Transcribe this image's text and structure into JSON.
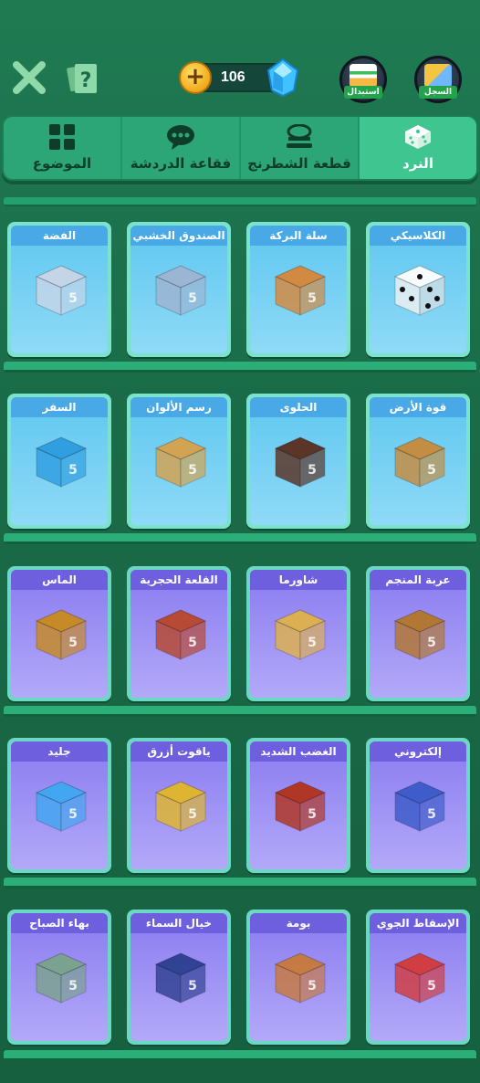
{
  "header": {
    "close_icon": "close-icon",
    "help_icon": "help-icon",
    "gem_count": "106",
    "coin_symbol": "+",
    "exchange_label": "استبدال",
    "history_label": "السجل"
  },
  "tabs": [
    {
      "label": "الموضوع",
      "icon": "grid-icon",
      "active": false
    },
    {
      "label": "فقاعة الدردشة",
      "icon": "chat-bubble-icon",
      "active": false
    },
    {
      "label": "قطعة الشطرنج",
      "icon": "chess-piece-icon",
      "active": false
    },
    {
      "label": "النرد",
      "icon": "dice-icon",
      "active": true
    }
  ],
  "rows": [
    [
      "الفضة",
      "الصندوق الخشبي",
      "سلة البركة",
      "الكلاسيكي"
    ],
    [
      "السفر",
      "رسم الألوان",
      "الحلوى",
      "قوة الأرض"
    ],
    [
      "الماس",
      "القلعة الحجرية",
      "شاورما",
      "عربة المنجم"
    ],
    [
      "جليد",
      "ياقوت أزرق",
      "الغضب الشديد",
      "إلكتروني"
    ],
    [
      "بهاء الصباح",
      "خيال السماء",
      "بومة",
      "الإسقاط الجوي"
    ]
  ],
  "colors": {
    "background": "#1a6b48",
    "tab_active": "#3fc590",
    "card_blue": "#5fc7ef",
    "card_purple": "#8a7bf0"
  }
}
